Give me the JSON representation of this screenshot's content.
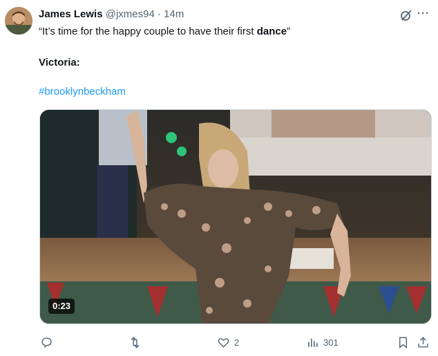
{
  "author": {
    "display_name": "James Lewis",
    "handle": "@jxmes94",
    "separator": "·",
    "time": "14m"
  },
  "post": {
    "line1_quote_open": "“It’s time for the happy couple to have their first ",
    "line1_bold": "dance",
    "line1_quote_close": "”",
    "line2": "Victoria:",
    "hashtag": "#brooklynbeckham"
  },
  "media": {
    "duration": "0:23"
  },
  "actions": {
    "replies": "",
    "reposts": "",
    "likes": "2",
    "views": "301"
  },
  "colors": {
    "link": "#1d9bf0",
    "muted": "#536471",
    "text": "#0f1419"
  }
}
